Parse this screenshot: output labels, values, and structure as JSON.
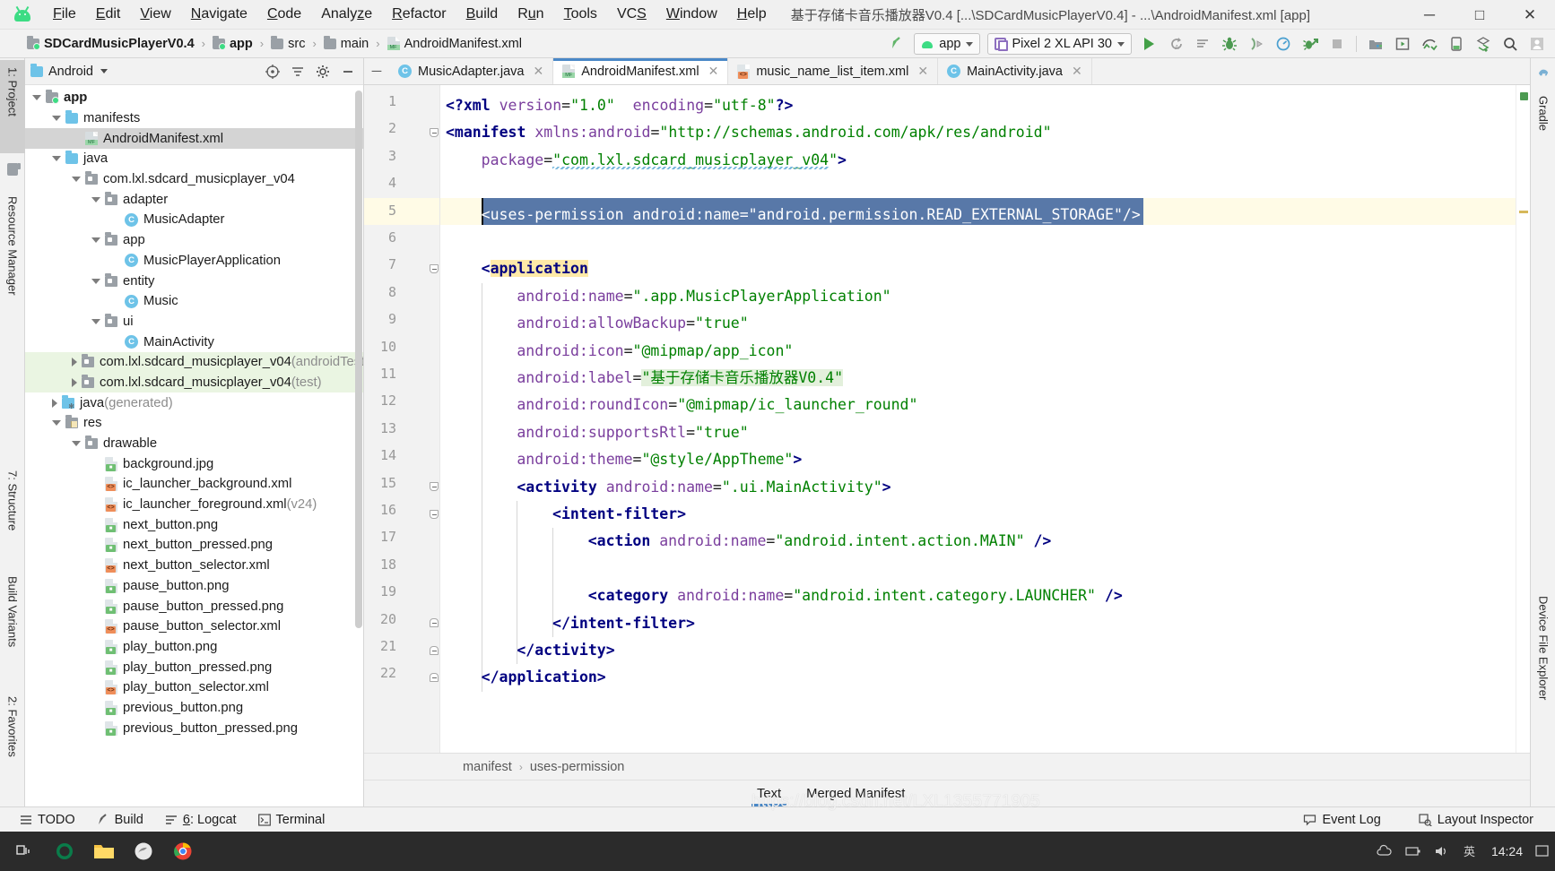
{
  "window": {
    "title": "基于存储卡音乐播放器V0.4 [...\\SDCardMusicPlayerV0.4] - ...\\AndroidManifest.xml [app]",
    "minimize": "—",
    "maximize": "▢",
    "close": "✕"
  },
  "menubar": {
    "items": [
      "File",
      "Edit",
      "View",
      "Navigate",
      "Code",
      "Analyze",
      "Refactor",
      "Build",
      "Run",
      "Tools",
      "VCS",
      "Window",
      "Help"
    ]
  },
  "breadcrumb_nav": {
    "segments": [
      "SDCardMusicPlayerV0.4",
      "app",
      "src",
      "main",
      "AndroidManifest.xml"
    ],
    "separator": "›"
  },
  "toolbar": {
    "run_config": "app",
    "device": "Pixel 2 XL API 30",
    "caret": "▾",
    "icons": [
      "make-project-icon",
      "run-icon",
      "run-coverage-icon",
      "run-with-profiler-list-icon",
      "debug-icon",
      "attach-debugger-icon",
      "profiler-icon",
      "apply-changes-icon",
      "stop-icon",
      "sdk-manager-icon",
      "avd-manager-icon",
      "layout-inspector-icon",
      "device-file-explorer-icon",
      "sync-gradle-icon",
      "search-everywhere-icon",
      "avatar-icon"
    ]
  },
  "left_strip": {
    "tabs": [
      {
        "label": "1: Project",
        "selected": true
      },
      {
        "label": "Resource Manager",
        "selected": false
      },
      {
        "label": "7: Structure",
        "selected": false
      },
      {
        "label": "Build Variants",
        "selected": false
      },
      {
        "label": "2: Favorites",
        "selected": false
      }
    ]
  },
  "right_strip": {
    "tabs": [
      {
        "label": "Gradle",
        "selected": false
      },
      {
        "label": "Device File Explorer",
        "selected": false
      }
    ]
  },
  "project_panel": {
    "title": "Android",
    "header_icons": [
      "target-icon",
      "collapse-all-icon",
      "settings-gear-icon",
      "hide-icon"
    ],
    "tree": [
      {
        "depth": 0,
        "label": "app",
        "suffix": "",
        "icon": "folder-module",
        "arrow": "down",
        "bold": true,
        "state": "normal"
      },
      {
        "depth": 1,
        "label": "manifests",
        "suffix": "",
        "icon": "folder-blue",
        "arrow": "down",
        "bold": false,
        "state": "normal"
      },
      {
        "depth": 2,
        "label": "AndroidManifest.xml",
        "suffix": "",
        "icon": "file-mf",
        "arrow": "none",
        "bold": false,
        "state": "selected"
      },
      {
        "depth": 1,
        "label": "java",
        "suffix": "",
        "icon": "folder-blue",
        "arrow": "down",
        "bold": false,
        "state": "normal"
      },
      {
        "depth": 2,
        "label": "com.lxl.sdcard_musicplayer_v04",
        "suffix": "",
        "icon": "package",
        "arrow": "down",
        "bold": false,
        "state": "normal"
      },
      {
        "depth": 3,
        "label": "adapter",
        "suffix": "",
        "icon": "package",
        "arrow": "down",
        "bold": false,
        "state": "normal"
      },
      {
        "depth": 4,
        "label": "MusicAdapter",
        "suffix": "",
        "icon": "class",
        "arrow": "none",
        "bold": false,
        "state": "normal"
      },
      {
        "depth": 3,
        "label": "app",
        "suffix": "",
        "icon": "package",
        "arrow": "down",
        "bold": false,
        "state": "normal"
      },
      {
        "depth": 4,
        "label": "MusicPlayerApplication",
        "suffix": "",
        "icon": "class",
        "arrow": "none",
        "bold": false,
        "state": "normal"
      },
      {
        "depth": 3,
        "label": "entity",
        "suffix": "",
        "icon": "package",
        "arrow": "down",
        "bold": false,
        "state": "normal"
      },
      {
        "depth": 4,
        "label": "Music",
        "suffix": "",
        "icon": "class",
        "arrow": "none",
        "bold": false,
        "state": "normal"
      },
      {
        "depth": 3,
        "label": "ui",
        "suffix": "",
        "icon": "package",
        "arrow": "down",
        "bold": false,
        "state": "normal"
      },
      {
        "depth": 4,
        "label": "MainActivity",
        "suffix": "",
        "icon": "class",
        "arrow": "none",
        "bold": false,
        "state": "normal"
      },
      {
        "depth": 2,
        "label": "com.lxl.sdcard_musicplayer_v04",
        "suffix": " (androidTest)",
        "icon": "package",
        "arrow": "right",
        "bold": false,
        "state": "testsrc"
      },
      {
        "depth": 2,
        "label": "com.lxl.sdcard_musicplayer_v04",
        "suffix": " (test)",
        "icon": "package",
        "arrow": "right",
        "bold": false,
        "state": "testsrc"
      },
      {
        "depth": 1,
        "label": "java",
        "suffix": " (generated)",
        "icon": "folder-generated",
        "arrow": "right",
        "bold": false,
        "state": "normal"
      },
      {
        "depth": 1,
        "label": "res",
        "suffix": "",
        "icon": "folder-res",
        "arrow": "down",
        "bold": false,
        "state": "normal"
      },
      {
        "depth": 2,
        "label": "drawable",
        "suffix": "",
        "icon": "package",
        "arrow": "down",
        "bold": false,
        "state": "normal"
      },
      {
        "depth": 3,
        "label": "background.jpg",
        "suffix": "",
        "icon": "file-img",
        "arrow": "none",
        "bold": false,
        "state": "normal"
      },
      {
        "depth": 3,
        "label": "ic_launcher_background.xml",
        "suffix": "",
        "icon": "file-xml",
        "arrow": "none",
        "bold": false,
        "state": "normal"
      },
      {
        "depth": 3,
        "label": "ic_launcher_foreground.xml",
        "suffix": " (v24)",
        "icon": "file-xml",
        "arrow": "none",
        "bold": false,
        "state": "normal"
      },
      {
        "depth": 3,
        "label": "next_button.png",
        "suffix": "",
        "icon": "file-img",
        "arrow": "none",
        "bold": false,
        "state": "normal"
      },
      {
        "depth": 3,
        "label": "next_button_pressed.png",
        "suffix": "",
        "icon": "file-img",
        "arrow": "none",
        "bold": false,
        "state": "normal"
      },
      {
        "depth": 3,
        "label": "next_button_selector.xml",
        "suffix": "",
        "icon": "file-xml",
        "arrow": "none",
        "bold": false,
        "state": "normal"
      },
      {
        "depth": 3,
        "label": "pause_button.png",
        "suffix": "",
        "icon": "file-img",
        "arrow": "none",
        "bold": false,
        "state": "normal"
      },
      {
        "depth": 3,
        "label": "pause_button_pressed.png",
        "suffix": "",
        "icon": "file-img",
        "arrow": "none",
        "bold": false,
        "state": "normal"
      },
      {
        "depth": 3,
        "label": "pause_button_selector.xml",
        "suffix": "",
        "icon": "file-xml",
        "arrow": "none",
        "bold": false,
        "state": "normal"
      },
      {
        "depth": 3,
        "label": "play_button.png",
        "suffix": "",
        "icon": "file-img",
        "arrow": "none",
        "bold": false,
        "state": "normal"
      },
      {
        "depth": 3,
        "label": "play_button_pressed.png",
        "suffix": "",
        "icon": "file-img",
        "arrow": "none",
        "bold": false,
        "state": "normal"
      },
      {
        "depth": 3,
        "label": "play_button_selector.xml",
        "suffix": "",
        "icon": "file-xml",
        "arrow": "none",
        "bold": false,
        "state": "normal"
      },
      {
        "depth": 3,
        "label": "previous_button.png",
        "suffix": "",
        "icon": "file-img",
        "arrow": "none",
        "bold": false,
        "state": "normal"
      },
      {
        "depth": 3,
        "label": "previous_button_pressed.png",
        "suffix": "",
        "icon": "file-img",
        "arrow": "none",
        "bold": false,
        "state": "normal"
      }
    ]
  },
  "editor": {
    "tabs": [
      {
        "label": "MusicAdapter.java",
        "icon": "java-class-icon",
        "active": false,
        "close": "✕"
      },
      {
        "label": "AndroidManifest.xml",
        "icon": "manifest-file-icon",
        "active": true,
        "close": "✕"
      },
      {
        "label": "music_name_list_item.xml",
        "icon": "xml-layout-file-icon",
        "active": false,
        "close": "✕"
      },
      {
        "label": "MainActivity.java",
        "icon": "java-class-icon",
        "active": false,
        "close": "✕"
      }
    ],
    "line_numbers": [
      1,
      2,
      3,
      4,
      5,
      6,
      7,
      8,
      9,
      10,
      11,
      12,
      13,
      14,
      15,
      16,
      17,
      18,
      19,
      20,
      21,
      22
    ],
    "highlighted_line": 5,
    "lines": [
      {
        "n": 1,
        "indent": 0,
        "parts": [
          {
            "t": "<?xml ",
            "c": "k-pi"
          },
          {
            "t": "version",
            "c": "k-attr"
          },
          {
            "t": "=",
            "c": "k-eq"
          },
          {
            "t": "\"1.0\"",
            "c": "k-str"
          },
          {
            "t": "  ",
            "c": "k-eq"
          },
          {
            "t": "encoding",
            "c": "k-attr"
          },
          {
            "t": "=",
            "c": "k-eq"
          },
          {
            "t": "\"utf-8\"",
            "c": "k-str"
          },
          {
            "t": "?>",
            "c": "k-pi"
          }
        ]
      },
      {
        "n": 2,
        "indent": 0,
        "parts": [
          {
            "t": "<manifest ",
            "c": "k-tag"
          },
          {
            "t": "xmlns:android",
            "c": "k-attr"
          },
          {
            "t": "=",
            "c": "k-eq"
          },
          {
            "t": "\"http://schemas.android.com/apk/res/android\"",
            "c": "k-str"
          }
        ]
      },
      {
        "n": 3,
        "indent": 1,
        "parts": [
          {
            "t": "package",
            "c": "k-attr"
          },
          {
            "t": "=",
            "c": "k-eq"
          },
          {
            "t": "\"com.lxl.sdcard_musicplayer_v04\"",
            "c": "k-str"
          },
          {
            "t": ">",
            "c": "k-tag"
          }
        ]
      },
      {
        "n": 4,
        "indent": 0,
        "parts": []
      },
      {
        "n": 5,
        "indent": 1,
        "parts": [
          {
            "t": "<uses-permission android:name=\"android.permission.READ_EXTERNAL_STORAGE\"/>",
            "c": "k-white"
          }
        ]
      },
      {
        "n": 6,
        "indent": 0,
        "parts": []
      },
      {
        "n": 7,
        "indent": 1,
        "parts": [
          {
            "t": "<",
            "c": "k-tag"
          },
          {
            "t": "application",
            "c": "k-tag hl-yellow"
          }
        ]
      },
      {
        "n": 8,
        "indent": 2,
        "parts": [
          {
            "t": "android:name",
            "c": "k-attr"
          },
          {
            "t": "=",
            "c": "k-eq"
          },
          {
            "t": "\".app.MusicPlayerApplication\"",
            "c": "k-str"
          }
        ]
      },
      {
        "n": 9,
        "indent": 2,
        "parts": [
          {
            "t": "android:allowBackup",
            "c": "k-attr"
          },
          {
            "t": "=",
            "c": "k-eq"
          },
          {
            "t": "\"true\"",
            "c": "k-str"
          }
        ]
      },
      {
        "n": 10,
        "indent": 2,
        "parts": [
          {
            "t": "android:icon",
            "c": "k-attr"
          },
          {
            "t": "=",
            "c": "k-eq"
          },
          {
            "t": "\"@mipmap/app_icon\"",
            "c": "k-str"
          }
        ]
      },
      {
        "n": 11,
        "indent": 2,
        "parts": [
          {
            "t": "android:label",
            "c": "k-attr"
          },
          {
            "t": "=",
            "c": "k-eq"
          },
          {
            "t": "\"基于存储卡音乐播放器V0.4\"",
            "c": "k-str hl-green"
          }
        ]
      },
      {
        "n": 12,
        "indent": 2,
        "parts": [
          {
            "t": "android:roundIcon",
            "c": "k-attr"
          },
          {
            "t": "=",
            "c": "k-eq"
          },
          {
            "t": "\"@mipmap/ic_launcher_round\"",
            "c": "k-str"
          }
        ]
      },
      {
        "n": 13,
        "indent": 2,
        "parts": [
          {
            "t": "android:supportsRtl",
            "c": "k-attr"
          },
          {
            "t": "=",
            "c": "k-eq"
          },
          {
            "t": "\"true\"",
            "c": "k-str"
          }
        ]
      },
      {
        "n": 14,
        "indent": 2,
        "parts": [
          {
            "t": "android:theme",
            "c": "k-attr"
          },
          {
            "t": "=",
            "c": "k-eq"
          },
          {
            "t": "\"@style/AppTheme\"",
            "c": "k-str"
          },
          {
            "t": ">",
            "c": "k-tag"
          }
        ]
      },
      {
        "n": 15,
        "indent": 2,
        "parts": [
          {
            "t": "<activity ",
            "c": "k-tag"
          },
          {
            "t": "android:name",
            "c": "k-attr"
          },
          {
            "t": "=",
            "c": "k-eq"
          },
          {
            "t": "\".ui.MainActivity\"",
            "c": "k-str"
          },
          {
            "t": ">",
            "c": "k-tag"
          }
        ]
      },
      {
        "n": 16,
        "indent": 3,
        "parts": [
          {
            "t": "<intent-filter>",
            "c": "k-tag"
          }
        ]
      },
      {
        "n": 17,
        "indent": 4,
        "parts": [
          {
            "t": "<action ",
            "c": "k-tag"
          },
          {
            "t": "android:name",
            "c": "k-attr"
          },
          {
            "t": "=",
            "c": "k-eq"
          },
          {
            "t": "\"android.intent.action.MAIN\"",
            "c": "k-str"
          },
          {
            "t": " />",
            "c": "k-tag"
          }
        ]
      },
      {
        "n": 18,
        "indent": 0,
        "parts": []
      },
      {
        "n": 19,
        "indent": 4,
        "parts": [
          {
            "t": "<category ",
            "c": "k-tag"
          },
          {
            "t": "android:name",
            "c": "k-attr"
          },
          {
            "t": "=",
            "c": "k-eq"
          },
          {
            "t": "\"android.intent.category.LAUNCHER\"",
            "c": "k-str"
          },
          {
            "t": " />",
            "c": "k-tag"
          }
        ]
      },
      {
        "n": 20,
        "indent": 3,
        "parts": [
          {
            "t": "</intent-filter>",
            "c": "k-tag"
          }
        ]
      },
      {
        "n": 21,
        "indent": 2,
        "parts": [
          {
            "t": "</activity>",
            "c": "k-tag"
          }
        ]
      },
      {
        "n": 22,
        "indent": 1,
        "parts": [
          {
            "t": "</application>",
            "c": "k-tag"
          }
        ]
      }
    ],
    "selected_text": "<uses-permission android:name=\"android.permission.READ_EXTERNAL_STORAGE\"/>",
    "breadcrumbs": [
      "manifest",
      "uses-permission"
    ],
    "breadcrumb_sep": "›",
    "bottom_tabs": [
      {
        "label": "Text",
        "active": true
      },
      {
        "label": "Merged Manifest",
        "active": false
      }
    ]
  },
  "statusbar": {
    "left_items": [
      {
        "label": "TODO",
        "icon": "todo-icon"
      },
      {
        "label": "Build",
        "icon": "build-hammer-icon"
      },
      {
        "label": "6: Logcat",
        "icon": "logcat-icon"
      },
      {
        "label": "Terminal",
        "icon": "terminal-icon"
      }
    ],
    "right_items": [
      {
        "label": "Event Log",
        "icon": "event-log-icon"
      },
      {
        "label": "Layout Inspector",
        "icon": "layout-inspector-icon"
      }
    ]
  },
  "taskbar": {
    "icons": [
      "task-view-icon",
      "cortana-icon",
      "file-explorer-icon",
      "firefox-icon",
      "chrome-icon"
    ],
    "clock": "14:24",
    "tray": [
      "onedrive-icon",
      "network-icon",
      "battery-icon",
      "volume-icon",
      "ime-icon"
    ]
  },
  "watermark": "https://blog.csdn.net/LXL1355771905"
}
